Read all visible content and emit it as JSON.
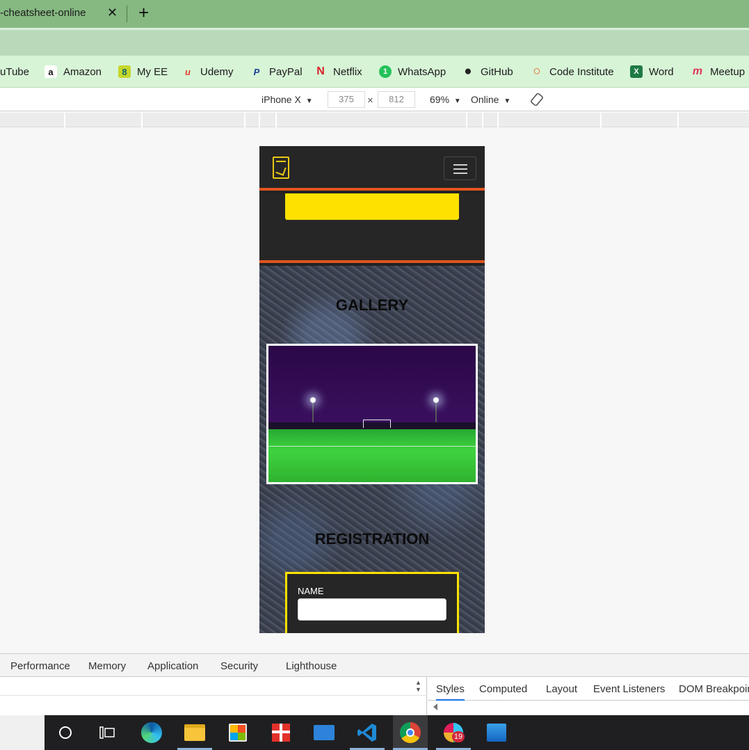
{
  "browser": {
    "tab_title": "-cheatsheet-online",
    "tab_close": "✕",
    "new_tab": "+",
    "bookmarks": [
      {
        "label": "uTube",
        "icon": "youtube-icon"
      },
      {
        "label": "Amazon",
        "icon": "amazon-icon",
        "glyph": "a"
      },
      {
        "label": "My EE",
        "icon": "ee-icon",
        "glyph": "8"
      },
      {
        "label": "Udemy",
        "icon": "udemy-icon",
        "glyph": "u"
      },
      {
        "label": "PayPal",
        "icon": "paypal-icon",
        "glyph": "P"
      },
      {
        "label": "Netflix",
        "icon": "netflix-icon",
        "glyph": "N"
      },
      {
        "label": "WhatsApp",
        "icon": "whatsapp-icon",
        "glyph": "1"
      },
      {
        "label": "GitHub",
        "icon": "github-icon",
        "glyph": "●"
      },
      {
        "label": "Code Institute",
        "icon": "code-institute-icon",
        "glyph": "○"
      },
      {
        "label": "Word",
        "icon": "excel-icon",
        "glyph": "X"
      },
      {
        "label": "Meetup",
        "icon": "meetup-icon",
        "glyph": "m"
      }
    ]
  },
  "device_toolbar": {
    "device": "iPhone X",
    "width": "375",
    "times": "×",
    "height": "812",
    "zoom": "69%",
    "throttle": "Online",
    "dropdown_glyph": "▼"
  },
  "site": {
    "gallery_heading": "GALLERY",
    "registration_heading": "REGISTRATION",
    "name_label": "NAME",
    "name_value": ""
  },
  "devtools": {
    "tabs": [
      "Performance",
      "Memory",
      "Application",
      "Security",
      "Lighthouse"
    ],
    "styles_tabs": [
      "Styles",
      "Computed",
      "Layout",
      "Event Listeners",
      "DOM Breakpoin"
    ],
    "active_styles_tab": "Styles"
  },
  "taskbar": {
    "items": [
      "search-circle-icon",
      "task-view-icon",
      "edge-icon",
      "file-explorer-icon",
      "store-icon",
      "gift-icon",
      "mail-icon",
      "vscode-icon",
      "chrome-icon",
      "slack-icon",
      "photos-icon"
    ],
    "slack_badge": "19"
  },
  "colors": {
    "accent_orange": "#e25420",
    "accent_yellow": "#ffe100",
    "tab_green": "#86b982"
  }
}
